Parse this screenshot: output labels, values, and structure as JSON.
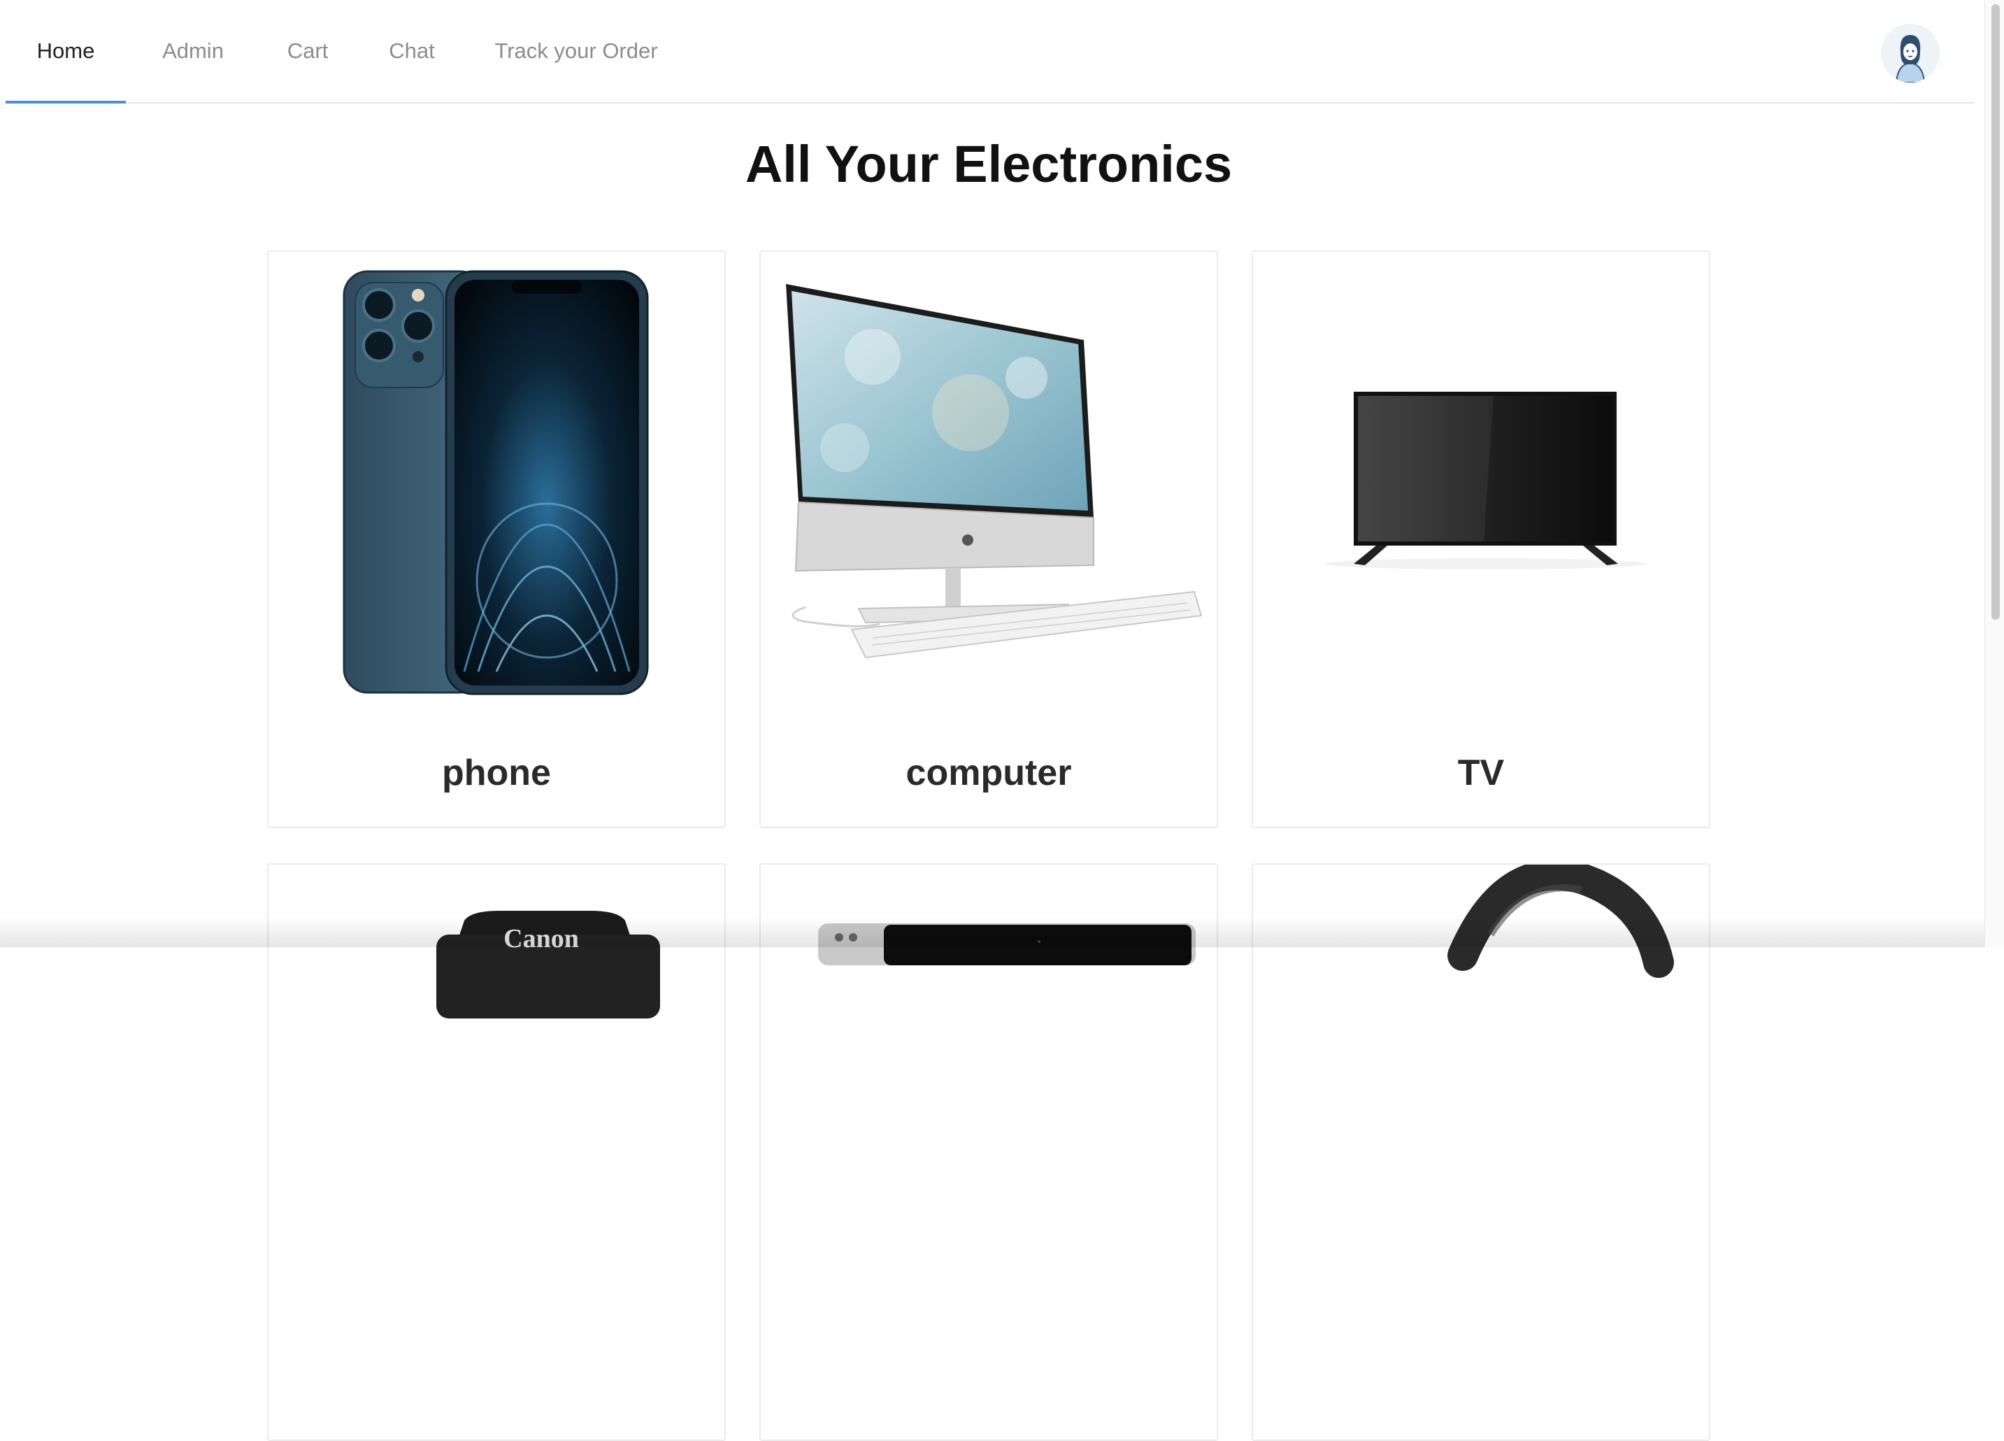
{
  "nav": {
    "tabs": [
      {
        "label": "Home",
        "active": true
      },
      {
        "label": "Admin",
        "active": false
      },
      {
        "label": "Cart",
        "active": false
      },
      {
        "label": "Chat",
        "active": false
      },
      {
        "label": "Track your Order",
        "active": false
      }
    ],
    "accent_color": "#4a90e2"
  },
  "main": {
    "title": "All Your Electronics",
    "categories": [
      {
        "name": "phone",
        "icon": "smartphone-image"
      },
      {
        "name": "computer",
        "icon": "desktop-computer-image"
      },
      {
        "name": "TV",
        "icon": "television-image"
      },
      {
        "name": "",
        "icon": "camera-image"
      },
      {
        "name": "",
        "icon": "laptop-image"
      },
      {
        "name": "",
        "icon": "headphones-image"
      }
    ]
  }
}
